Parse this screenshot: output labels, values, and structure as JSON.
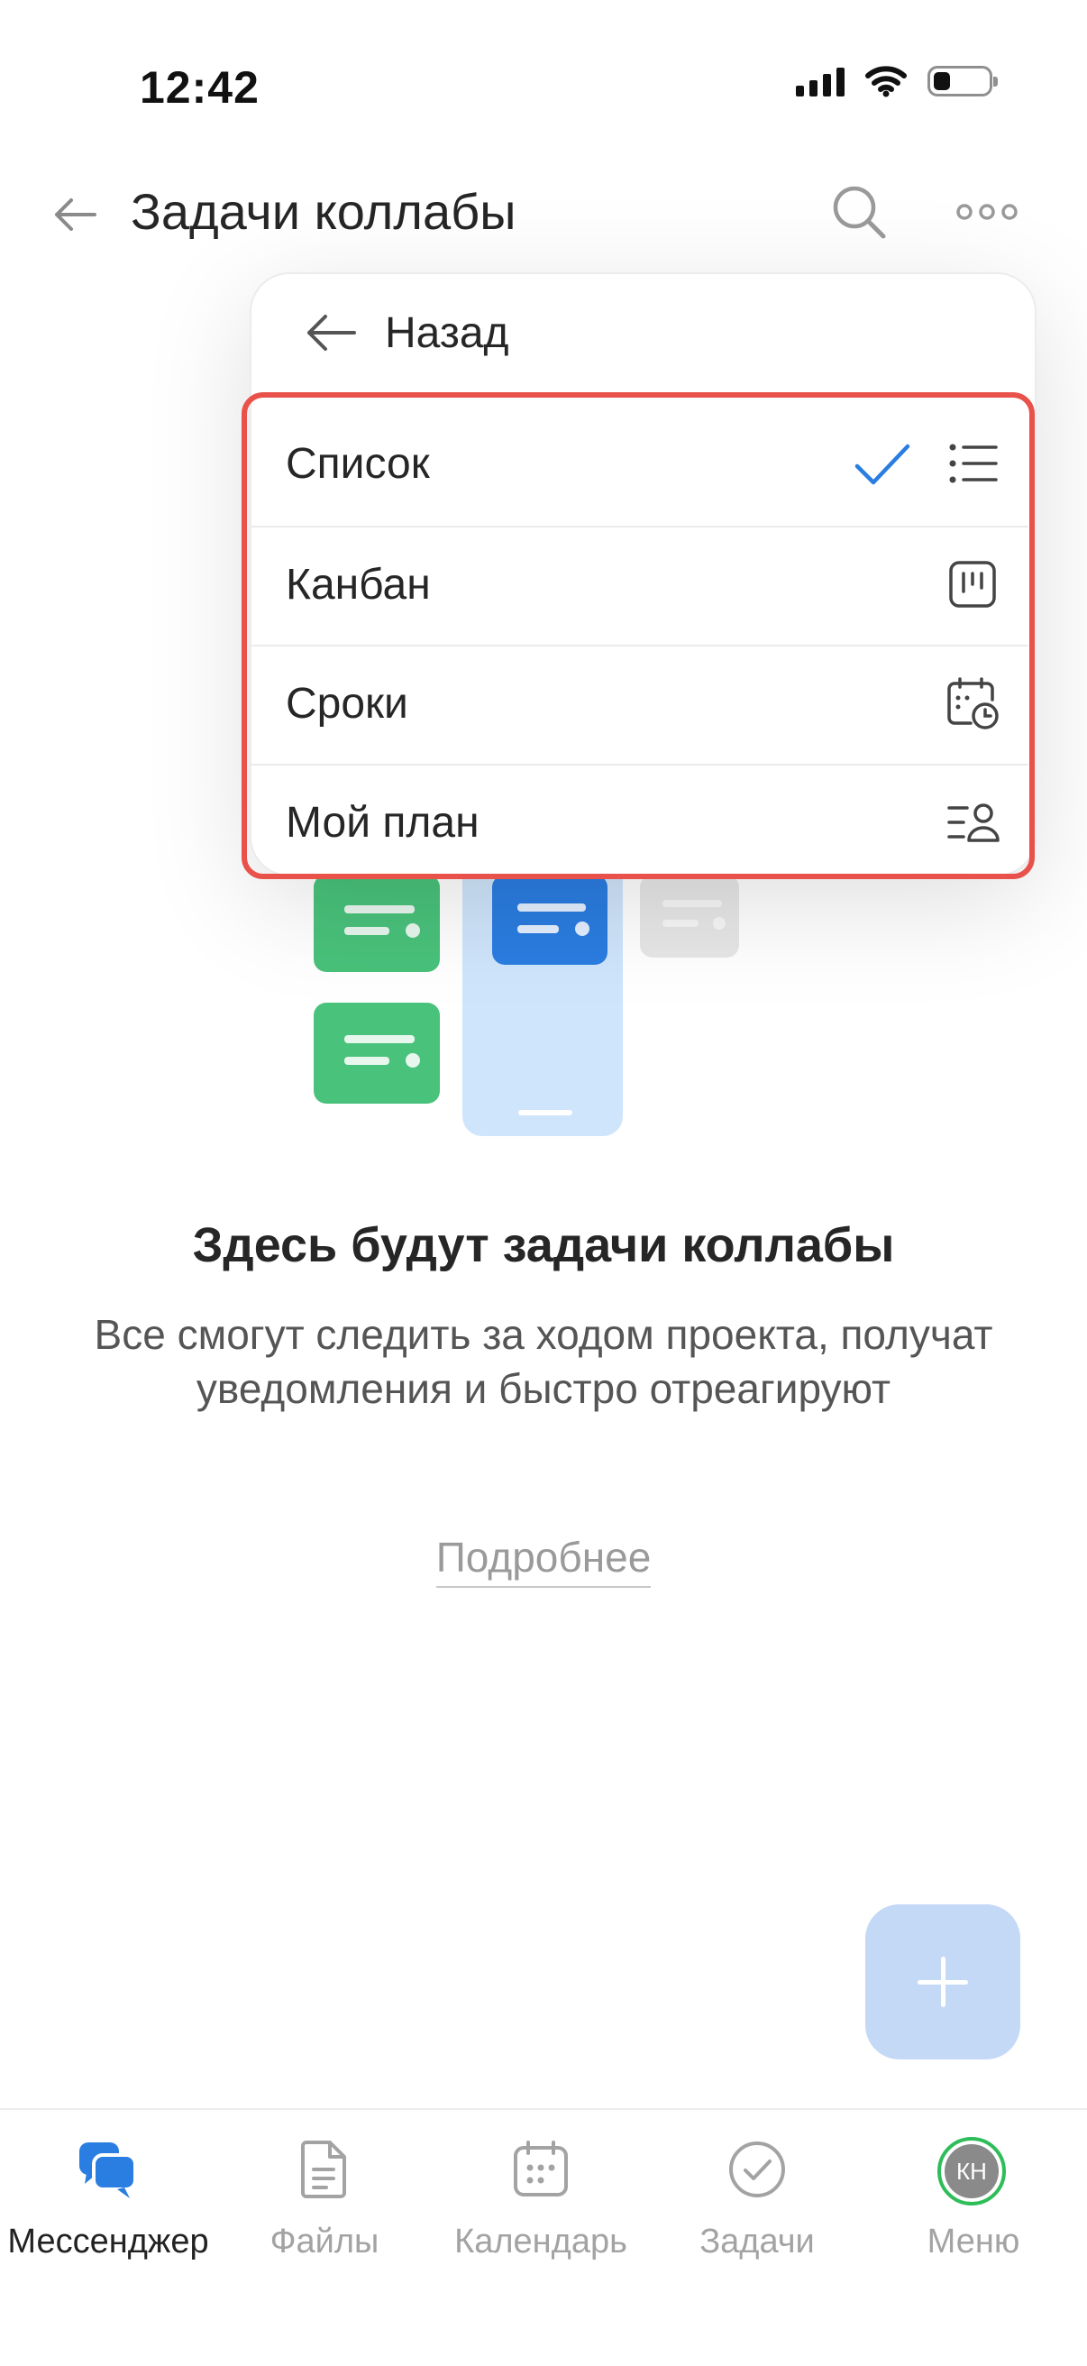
{
  "status_bar": {
    "time": "12:42"
  },
  "header": {
    "title": "Задачи коллабы",
    "icons": [
      "arrow-left-icon",
      "search-icon",
      "more-icon"
    ]
  },
  "dropdown": {
    "back_label": "Назад",
    "items": [
      {
        "label": "Список",
        "icon": "list-icon",
        "selected": true
      },
      {
        "label": "Канбан",
        "icon": "kanban-icon",
        "selected": false
      },
      {
        "label": "Сроки",
        "icon": "calendar-clock-icon",
        "selected": false
      },
      {
        "label": "Мой план",
        "icon": "person-list-icon",
        "selected": false
      }
    ]
  },
  "empty_state": {
    "title": "Здесь будут задачи коллабы",
    "description": "Все смогут следить за ходом проекта, получат уведомления и быстро отреагируют",
    "link": "Подробнее"
  },
  "bottom_nav": {
    "items": [
      {
        "label": "Мессенджер",
        "icon": "chat-icon",
        "active": true
      },
      {
        "label": "Файлы",
        "icon": "file-icon",
        "active": false
      },
      {
        "label": "Календарь",
        "icon": "calendar-icon",
        "active": false
      },
      {
        "label": "Задачи",
        "icon": "check-circle-icon",
        "active": false
      },
      {
        "label": "Меню",
        "icon": "avatar-icon",
        "active": false
      }
    ],
    "avatar_initials": "КН"
  },
  "colors": {
    "accent": "#2a7de1",
    "highlight": "#e8524a",
    "fab": "#c3d9f6",
    "avatar_ring": "#2ebd59"
  }
}
